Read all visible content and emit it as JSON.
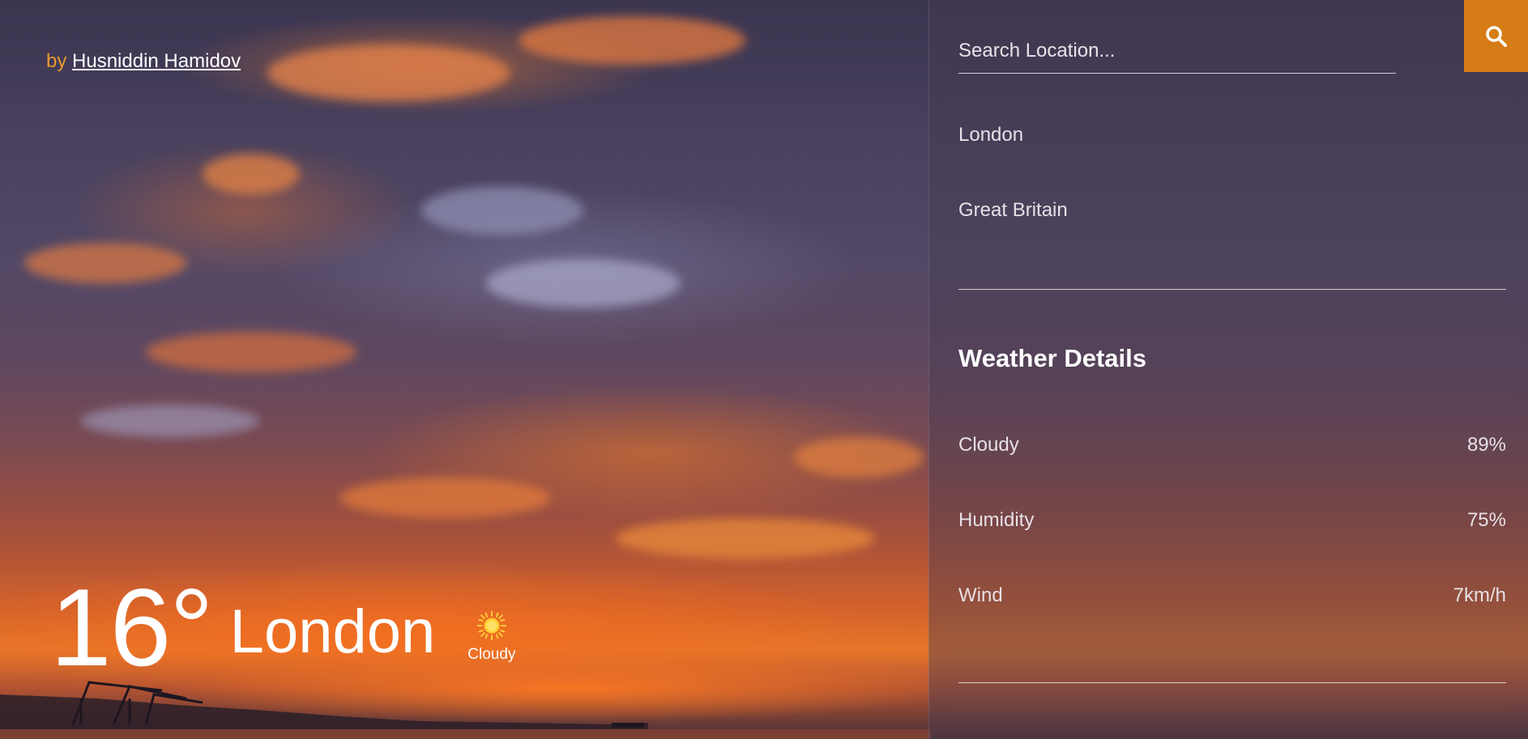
{
  "attribution": {
    "prefix": "by",
    "author": "Husniddin Hamidov"
  },
  "current": {
    "temperature": "16°",
    "city": "London",
    "condition": "Cloudy",
    "icon": "sun-icon"
  },
  "search": {
    "placeholder": "Search Location...",
    "value": "",
    "button_icon": "search-icon"
  },
  "locations": [
    {
      "label": "London"
    },
    {
      "label": "Great Britain"
    }
  ],
  "details": {
    "title": "Weather Details",
    "rows": [
      {
        "label": "Cloudy",
        "value": "89%"
      },
      {
        "label": "Humidity",
        "value": "75%"
      },
      {
        "label": "Wind",
        "value": "7km/h"
      }
    ]
  },
  "colors": {
    "accent": "#d67c16",
    "attribution_prefix": "#e99a2e"
  }
}
